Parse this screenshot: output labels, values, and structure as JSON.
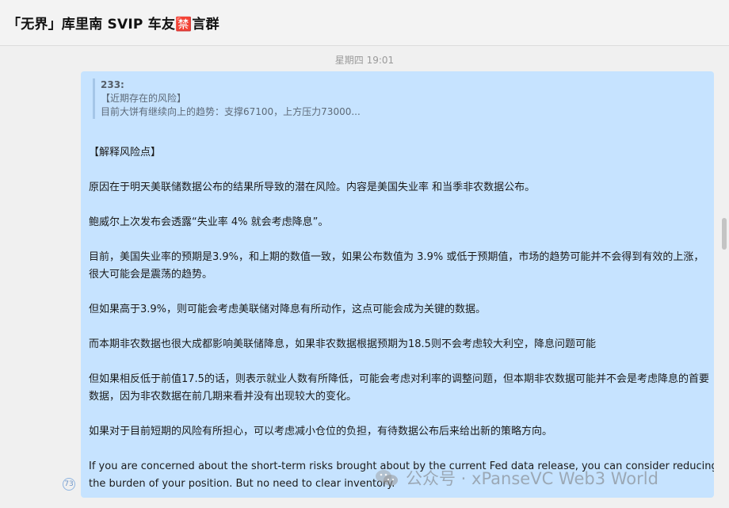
{
  "header": {
    "title": "「无界」库里南 SVIP 车友🈲言群"
  },
  "chat": {
    "timestamp": "星期四 19:01",
    "read_count": "73",
    "message": {
      "quote": {
        "author": "233:",
        "line1": "【近期存在的风险】",
        "line2": "目前大饼有继续向上的趋势：支撑67100，上方压力73000..."
      },
      "lines": [
        "【解释风险点】",
        "原因在于明天美联储数据公布的结果所导致的潜在风险。内容是美国失业率 和当季非农数据公布。",
        "鲍威尔上次发布会透露“失业率 4% 就会考虑降息”。",
        "目前，美国失业率的预期是3.9%，和上期的数值一致，如果公布数值为 3.9% 或低于预期值，市场的趋势可能并不会得到有效的上涨，",
        "很大可能会是震荡的趋势。",
        "但如果高于3.9%，则可能会考虑美联储对降息有所动作，这点可能会成为关键的数据。",
        "而本期非农数据也很大成都影响美联储降息，如果非农数据根据预期为18.5则不会考虑较大利空，降息问题可能",
        "但如果相反低于前值17.5的话，则表示就业人数有所降低，可能会考虑对利率的调整问题，但本期非农数据可能并不会是考虑降息的首要",
        "数据，因为非农数据在前几期来看并没有出现较大的变化。",
        "如果对于目前短期的风险有所担心，可以考虑减小仓位的负担，有待数据公布后来给出新的策略方向。",
        "If you are concerned about the short-term risks brought about by the current Fed data release, you can consider reducing",
        "the burden of your position. But no need to clear inventory."
      ]
    }
  },
  "watermark": {
    "text": "公众号 · xPanseVC Web3 World"
  },
  "icons": {
    "watermark": "wechat-icon",
    "read_receipt": "read-count-badge"
  }
}
